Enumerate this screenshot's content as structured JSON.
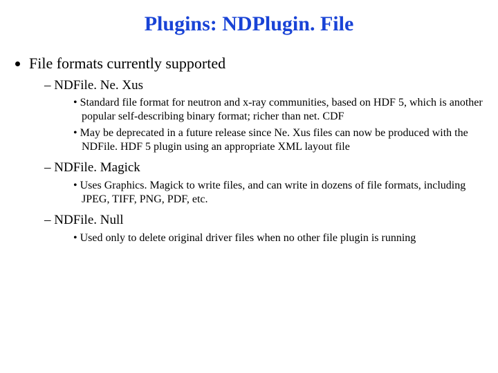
{
  "title": "Plugins: NDPlugin. File",
  "bullets": {
    "l1": "File formats currently supported",
    "sections": [
      {
        "name": "NDFile. Ne. Xus",
        "items": [
          "Standard file format for neutron and x-ray communities, based on HDF 5, which is another popular self-describing binary format; richer than net. CDF",
          "May be deprecated in a future release since Ne. Xus files can now be produced with the NDFile. HDF 5 plugin using an appropriate XML layout file"
        ]
      },
      {
        "name": "NDFile. Magick",
        "items": [
          "Uses Graphics. Magick to write files, and can write in dozens of file formats, including JPEG, TIFF, PNG, PDF, etc."
        ]
      },
      {
        "name": "NDFile. Null",
        "items": [
          "Used only to delete original driver files when no other file plugin is running"
        ]
      }
    ]
  }
}
